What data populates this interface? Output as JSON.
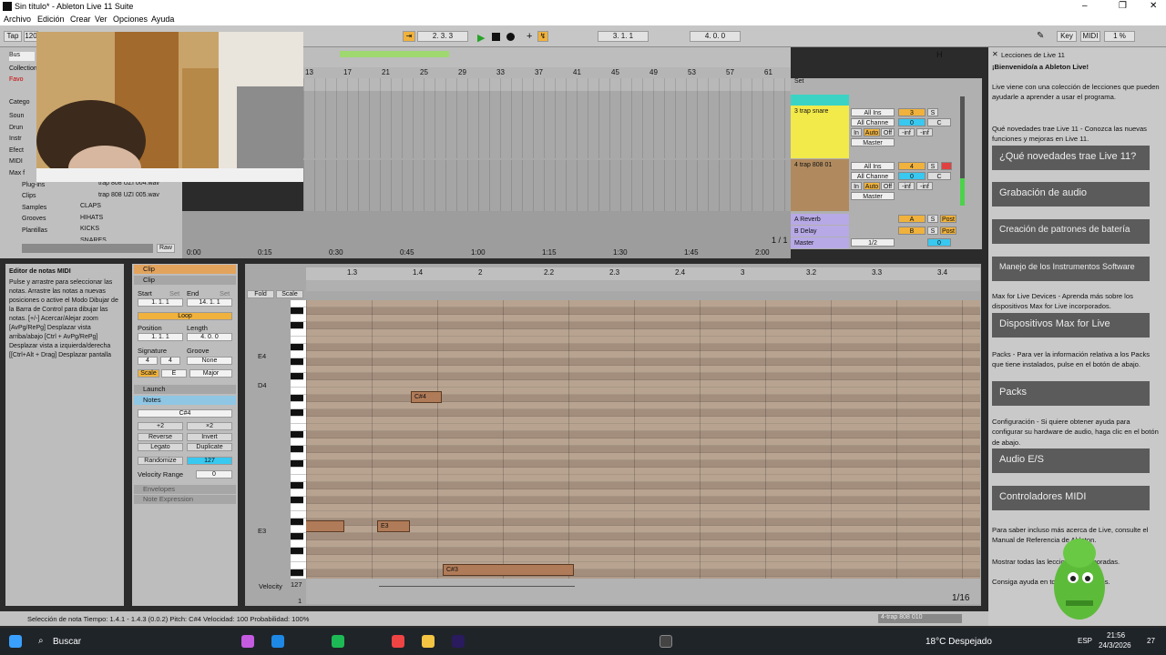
{
  "window": {
    "title": "Sin título* - Ableton Live 11 Suite"
  },
  "menu": [
    "Archivo",
    "Edición",
    "Crear",
    "Ver",
    "Opciones",
    "Ayuda"
  ],
  "transport": {
    "tap": "Tap",
    "tempo": "120",
    "pos1": "2. 3. 3",
    "pos2": "3. 1. 1",
    "pos3": "4. 0. 0",
    "key": "Key",
    "midi": "MIDI",
    "cpu": "1 %"
  },
  "browser": {
    "search": "Bus",
    "collections": "Collections",
    "fav": "Favo",
    "categories": "Catego",
    "items": [
      "Soun",
      "Drun",
      "Instr",
      "Efect",
      "MIDI",
      "Max f",
      "Plug-ins",
      "Clips",
      "Samples",
      "Grooves",
      "Plantillas"
    ],
    "files": [
      "trap 808 UZI 004.wav",
      "trap 808 UZI 005.wav",
      "CLAPS",
      "HIHATS",
      "KICKS",
      "SNARES"
    ],
    "raw": "Raw"
  },
  "arrangement": {
    "bars": [
      "13",
      "17",
      "21",
      "25",
      "29",
      "33",
      "37",
      "41",
      "45",
      "49",
      "53",
      "57",
      "61"
    ],
    "set": "Set",
    "page": "1 / 1",
    "times": [
      "0:00",
      "0:15",
      "0:30",
      "0:45",
      "1:00",
      "1:15",
      "1:30",
      "1:45",
      "2:00"
    ]
  },
  "tracks": [
    {
      "name": "3 trap snare",
      "input": "All Ins",
      "channel": "All Channe",
      "in": "In",
      "auto": "Auto",
      "off": "Off",
      "out": "Master",
      "num": "3",
      "s": "S",
      "vol": "0",
      "c": "C",
      "inf1": "-inf",
      "inf2": "-inf"
    },
    {
      "name": "4 trap 808 01",
      "input": "All Ins",
      "channel": "All Channe",
      "in": "In",
      "auto": "Auto",
      "off": "Off",
      "out": "Master",
      "num": "4",
      "s": "S",
      "vol": "0",
      "c": "C",
      "inf1": "-inf",
      "inf2": "-inf"
    }
  ],
  "returns": [
    {
      "name": "A Reverb",
      "label": "A",
      "s": "S",
      "post": "Post"
    },
    {
      "name": "B Delay",
      "label": "B",
      "s": "S",
      "post": "Post"
    },
    {
      "name": "Master",
      "label": "1/2",
      "vol": "0"
    }
  ],
  "lessons": {
    "title": "Lecciones de Live 11",
    "welcome": "¡Bienvenido/a a Ableton Live!",
    "intro": "Live viene con una colección de lecciones que pueden ayudarle a aprender a usar el programa.",
    "whats_new_text": "Qué novedades trae Live 11 - Conozca las nuevas funciones y mejoras en Live 11.",
    "buttons": [
      "¿Qué novedades trae Live 11?",
      "Grabación de audio",
      "Creación de patrones de batería",
      "Manejo de los Instrumentos Software",
      "Dispositivos Max for Live",
      "Packs",
      "Audio E/S",
      "Controladores MIDI"
    ],
    "max_text": "Max for Live Devices - Aprenda más sobre los dispositivos Max for Live incorporados.",
    "packs_text": "Packs - Para ver la información relativa a los Packs que tiene instalados, pulse en el botón de abajo.",
    "config_text": "Configuración - Si quiere obtener ayuda para configurar su hardware de audio, haga clic en el botón de abajo.",
    "more": "Para saber incluso más acerca de Live, consulte el Manual de Referencia de Ableton.",
    "show": "Mostrar todas las lecciones incorporadas.",
    "help": "Consiga ayuda en todas las lecciones."
  },
  "info": {
    "title": "Editor de notas MIDI",
    "body": "Pulse y arrastre para seleccionar las notas. Arrastre las notas a nuevas posiciones o active el Modo Dibujar de la Barra de Control para dibujar las notas. [+/-] Acercar/Alejar zoom [AvPg/RePg] Desplazar vista arriba/abajo [Ctrl + AvPg/RePg] Desplazar vista a izquierda/derecha [[Ctrl+Alt + Drag] Desplazar pantalla"
  },
  "clip": {
    "header": "Clip",
    "sub": "Clip",
    "start": "Start",
    "end": "End",
    "set": "Set",
    "start_val": "1. 1. 1",
    "end_val": "14. 1. 1",
    "loop": "Loop",
    "position": "Position",
    "length": "Length",
    "pos_val": "1. 1. 1",
    "len_val": "4. 0. 0",
    "signature": "Signature",
    "groove": "Groove",
    "sig_num": "4",
    "sig_den": "4",
    "groove_val": "None",
    "scale": "Scale",
    "scale_root": "E",
    "scale_type": "Major",
    "launch": "Launch",
    "notes": "Notes",
    "note_name": "C#4",
    "plus2": "+2",
    "times2": "×2",
    "reverse": "Reverse",
    "invert": "Invert",
    "legato": "Legato",
    "duplicate": "Duplicate",
    "randomize": "Randomize",
    "rand_val": "127",
    "velrange": "Velocity Range",
    "velrange_val": "0",
    "envelopes": "Envelopes",
    "note_expression": "Note Expression"
  },
  "pianoroll": {
    "ruler": [
      "1.3",
      "1.4",
      "2",
      "2.2",
      "2.3",
      "2.4",
      "3",
      "3.2",
      "3.3",
      "3.4"
    ],
    "fold": "Fold",
    "scale": "Scale",
    "key_labels": [
      "E4",
      "D4",
      "E3"
    ],
    "notes": [
      {
        "label": "C#4"
      },
      {
        "label": "E3"
      },
      {
        "label": "E3"
      },
      {
        "label": "C#3"
      }
    ],
    "velocity": "Velocity",
    "vel_max": "127",
    "vel_min": "1",
    "page": "1/16"
  },
  "status": {
    "text": "Selección de nota  Tiempo: 1.4.1 - 1.4.3 (0.0.2)  Pitch: C#4  Velocidad: 100  Probabilidad: 100%",
    "track": "4-trap 808 010"
  },
  "taskbar": {
    "search": "Buscar",
    "weather": "18°C  Despejado",
    "lang": "ESP",
    "time": "21:56",
    "date": "24/3/2026",
    "notif": "27"
  }
}
